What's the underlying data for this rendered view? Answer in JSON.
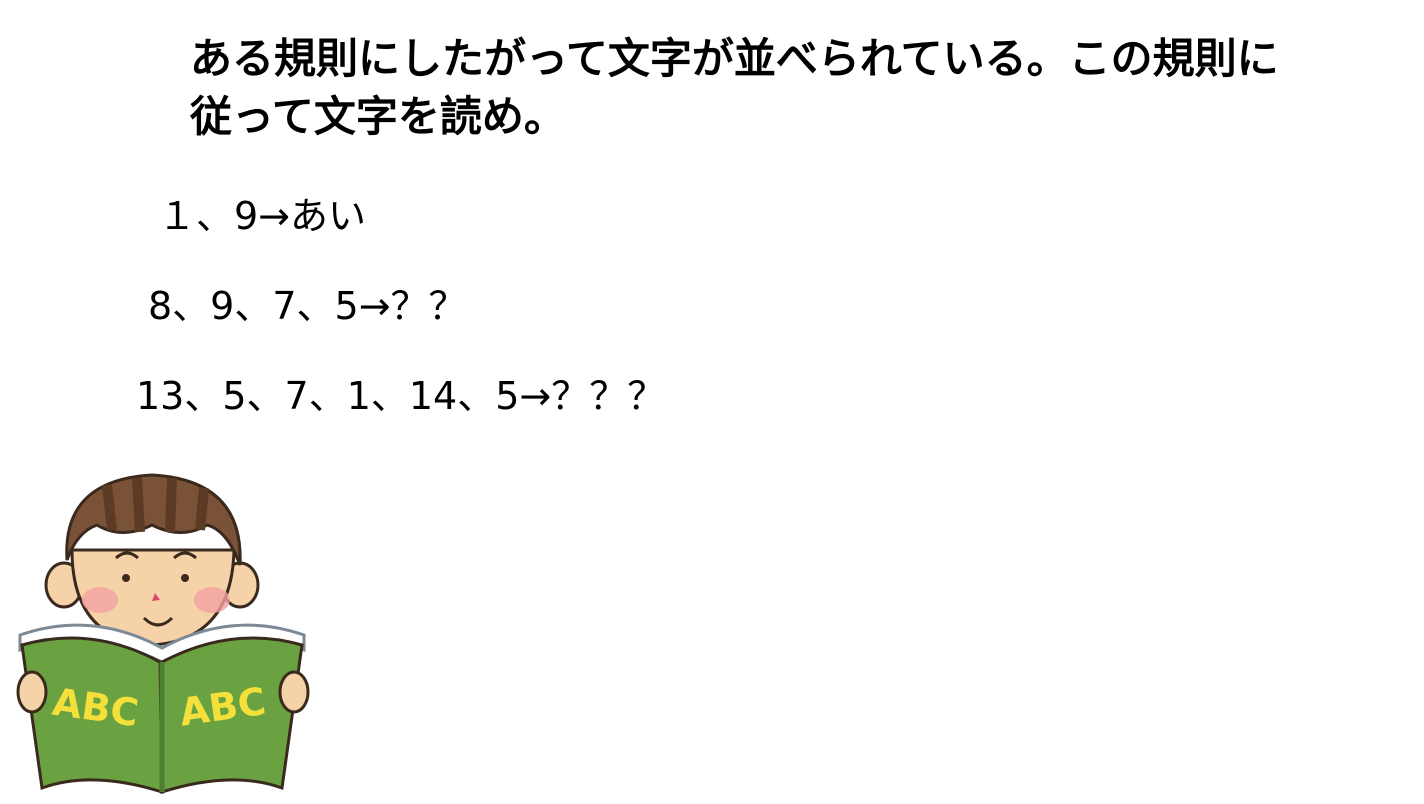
{
  "title": {
    "line1": "ある規則にしたがって文字が並べられている。この規則に",
    "line2": "従って文字を読め。"
  },
  "problems": [
    {
      "text": "１、9→あい"
    },
    {
      "text": "8、9、7、5→？？"
    },
    {
      "text": "13、5、7、1、14、5→？？？"
    }
  ],
  "illustration": {
    "name": "boy-reading-book",
    "book_cover_left": "ABC",
    "book_cover_right": "ABC",
    "colors": {
      "hair": "#7a5237",
      "hair_stripe": "#5c3a24",
      "skin": "#f6d2a8",
      "cheek": "#f3a1a1",
      "book": "#6aa241",
      "book_dark": "#4d7f2e",
      "book_text": "#f3e03a",
      "mouth": "#e0456a"
    }
  }
}
